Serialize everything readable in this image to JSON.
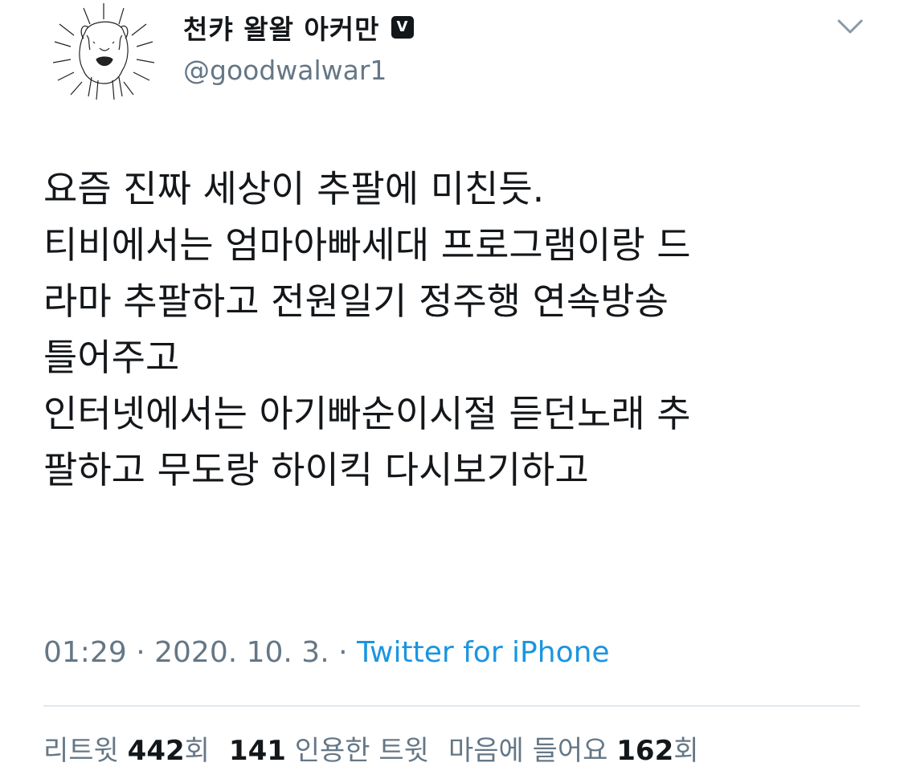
{
  "user": {
    "display_name": "천캬 왈왈 아커만",
    "badge_letter": "V",
    "handle": "@goodwalwar1",
    "avatar_icon": "dog-drawing-avatar"
  },
  "header": {
    "menu_icon": "chevron-down-icon"
  },
  "tweet": {
    "lines": [
      "요즘 진짜 세상이 추팔에 미친듯.",
      "티비에서는 엄마아빠세대 프로그램이랑 드",
      "라마 추팔하고 전원일기 정주행 연속방송",
      "틀어주고",
      "인터넷에서는 아기빠순이시절 듣던노래 추",
      "팔하고 무도랑 하이킥 다시보기하고"
    ]
  },
  "meta": {
    "time": "01:29",
    "separator": "·",
    "date": "2020. 10. 3.",
    "source": "Twitter for iPhone"
  },
  "stats": {
    "retweets_label": "리트윗",
    "retweets_count": "442",
    "retweets_suffix": "회",
    "quotes_count": "141",
    "quotes_label": "인용한 트윗",
    "likes_label": "마음에 들어요",
    "likes_count": "162",
    "likes_suffix": "회"
  },
  "colors": {
    "text_primary": "#14171a",
    "text_secondary": "#657786",
    "link": "#1b95e0",
    "divider": "#e1e8ed"
  }
}
